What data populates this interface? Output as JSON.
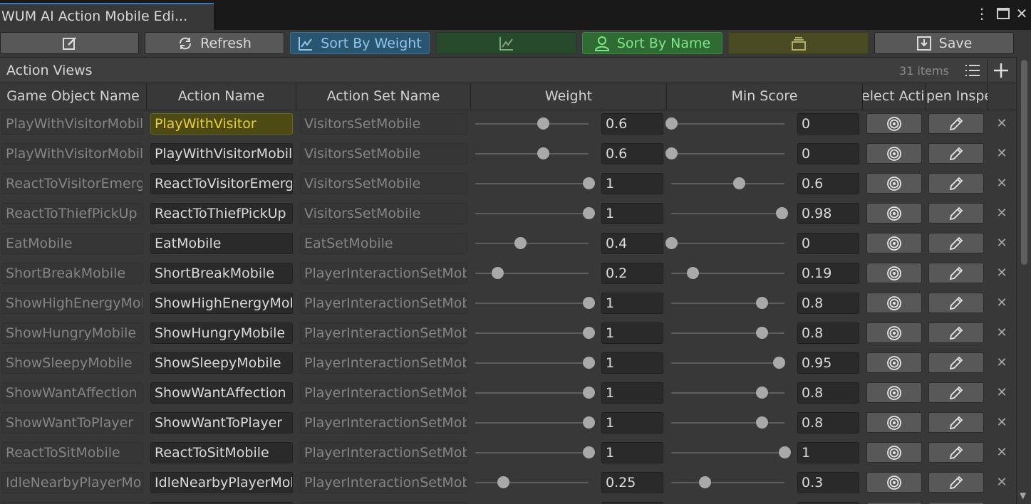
{
  "window": {
    "title": "WUM AI Action Mobile Edi..."
  },
  "toolbar": {
    "refresh_label": "Refresh",
    "sort_weight_label": "Sort By Weight",
    "sort_name_label": "Sort By Name",
    "save_label": "Save"
  },
  "section": {
    "title": "Action Views",
    "count": "31 items"
  },
  "columns": [
    "Game Object Name",
    "Action Name",
    "Action Set Name",
    "Weight",
    "Min Score",
    "Select Action",
    "Open Inspector"
  ],
  "rows": [
    {
      "game_object": "PlayWithVisitorMobile",
      "action": "PlayWithVisitor",
      "action_set": "VisitorsSetMobile",
      "weight": "0.6",
      "min_score": "0",
      "selected": true
    },
    {
      "game_object": "PlayWithVisitorMobile",
      "action": "PlayWithVisitorMobile",
      "action_set": "VisitorsSetMobile",
      "weight": "0.6",
      "min_score": "0"
    },
    {
      "game_object": "ReactToVisitorEmerge",
      "action": "ReactToVisitorEmerge",
      "action_set": "VisitorsSetMobile",
      "weight": "1",
      "min_score": "0.6"
    },
    {
      "game_object": "ReactToThiefPickUp",
      "action": "ReactToThiefPickUp",
      "action_set": "VisitorsSetMobile",
      "weight": "1",
      "min_score": "0.98"
    },
    {
      "game_object": "EatMobile",
      "action": "EatMobile",
      "action_set": "EatSetMobile",
      "weight": "0.4",
      "min_score": "0"
    },
    {
      "game_object": "ShortBreakMobile",
      "action": "ShortBreakMobile",
      "action_set": "PlayerInteractionSetMobile",
      "weight": "0.2",
      "min_score": "0.19"
    },
    {
      "game_object": "ShowHighEnergyMobile",
      "action": "ShowHighEnergyMobile",
      "action_set": "PlayerInteractionSetMobile",
      "weight": "1",
      "min_score": "0.8"
    },
    {
      "game_object": "ShowHungryMobile",
      "action": "ShowHungryMobile",
      "action_set": "PlayerInteractionSetMobile",
      "weight": "1",
      "min_score": "0.8"
    },
    {
      "game_object": "ShowSleepyMobile",
      "action": "ShowSleepyMobile",
      "action_set": "PlayerInteractionSetMobile",
      "weight": "1",
      "min_score": "0.95"
    },
    {
      "game_object": "ShowWantAffection",
      "action": "ShowWantAffection",
      "action_set": "PlayerInteractionSetMobile",
      "weight": "1",
      "min_score": "0.8"
    },
    {
      "game_object": "ShowWantToPlayer",
      "action": "ShowWantToPlayer",
      "action_set": "PlayerInteractionSetMobile",
      "weight": "1",
      "min_score": "0.8"
    },
    {
      "game_object": "ReactToSitMobile",
      "action": "ReactToSitMobile",
      "action_set": "PlayerInteractionSetMobile",
      "weight": "1",
      "min_score": "1"
    },
    {
      "game_object": "IdleNearbyPlayerMobile",
      "action": "IdleNearbyPlayerMobile",
      "action_set": "PlayerInteractionSetMobile",
      "weight": "0.25",
      "min_score": "0.3"
    },
    {
      "game_object": "",
      "action": "",
      "action_set": "",
      "weight": "",
      "min_score": ""
    }
  ]
}
